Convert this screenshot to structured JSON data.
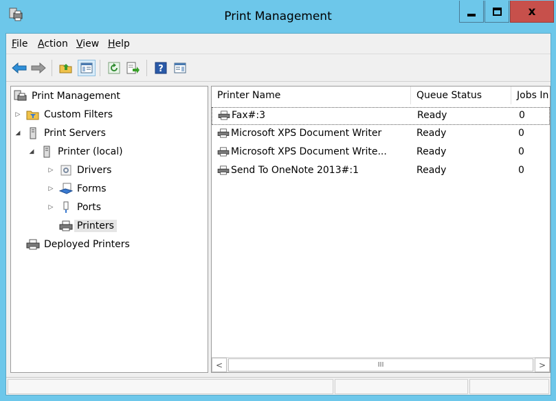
{
  "window": {
    "title": "Print Management",
    "close_glyph": "x"
  },
  "menu": {
    "file": "File",
    "action": "Action",
    "view": "View",
    "help": "Help"
  },
  "toolbar": {
    "icons": [
      "back-arrow-icon",
      "forward-arrow-icon",
      "up-folder-icon",
      "show-hide-tree-icon",
      "refresh-icon",
      "export-list-icon",
      "help-icon",
      "show-hide-action-pane-icon"
    ]
  },
  "tree": {
    "items": [
      {
        "label": "Print Management",
        "icon": "print-management-icon",
        "twist": ""
      },
      {
        "label": "Custom Filters",
        "icon": "filter-folder-icon",
        "twist": "▷"
      },
      {
        "label": "Print Servers",
        "icon": "server-icon",
        "twist": "◢"
      },
      {
        "label": "Printer (local)",
        "icon": "server-icon",
        "twist": "◢"
      },
      {
        "label": "Drivers",
        "icon": "drivers-icon",
        "twist": "▷"
      },
      {
        "label": "Forms",
        "icon": "forms-icon",
        "twist": "▷"
      },
      {
        "label": "Ports",
        "icon": "ports-icon",
        "twist": "▷"
      },
      {
        "label": "Printers",
        "icon": "printer-icon",
        "twist": ""
      },
      {
        "label": "Deployed Printers",
        "icon": "printer-icon",
        "twist": ""
      }
    ]
  },
  "list": {
    "columns": [
      "Printer Name",
      "Queue Status",
      "Jobs In"
    ],
    "rows": [
      {
        "name": "Fax#:3",
        "status": "Ready",
        "jobs": "0"
      },
      {
        "name": "Microsoft XPS Document Writer",
        "status": "Ready",
        "jobs": "0"
      },
      {
        "name": "Microsoft XPS Document Write...",
        "status": "Ready",
        "jobs": "0"
      },
      {
        "name": "Send To OneNote 2013#:1",
        "status": "Ready",
        "jobs": "0"
      }
    ],
    "scroll_left": "<",
    "scroll_right": ">",
    "scroll_grip": "III"
  },
  "colors": {
    "title_bar": "#6dc7ea",
    "close_button": "#c7504b",
    "selection": "#e5e5e5"
  }
}
